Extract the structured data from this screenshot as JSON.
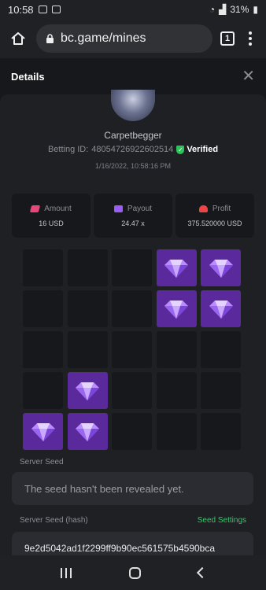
{
  "status_bar": {
    "time": "10:58",
    "battery": "31%"
  },
  "browser": {
    "url": "bc.game/mines",
    "tab_count": "1"
  },
  "modal": {
    "title": "Details"
  },
  "bet": {
    "username": "Carpetbegger",
    "betting_id_label": "Betting ID:",
    "betting_id": "48054726922602514",
    "verified_label": "Verified",
    "date": "1/16/2022, 10:58:16 PM"
  },
  "stats": {
    "amount_label": "Amount",
    "amount_value": "16 USD",
    "payout_label": "Payout",
    "payout_value": "24.47 x",
    "profit_label": "Profit",
    "profit_value": "375.520000 USD"
  },
  "mines_grid": {
    "rows": 5,
    "cols": 5,
    "gems": [
      [
        0,
        3
      ],
      [
        0,
        4
      ],
      [
        1,
        3
      ],
      [
        1,
        4
      ],
      [
        3,
        1
      ],
      [
        4,
        0
      ],
      [
        4,
        1
      ]
    ],
    "gem_color": "#5a2a9c"
  },
  "server_seed": {
    "label": "Server Seed",
    "value": "The seed hasn't been revealed yet."
  },
  "server_seed_hash": {
    "label": "Server Seed (hash)",
    "settings_label": "Seed Settings",
    "value": "9e2d5042ad1f2299ff9b90ec561575b4590bca"
  },
  "colors": {
    "accent_green": "#3cc56a",
    "verified_green": "#2bc35a",
    "gem_purple": "#5a2a9c"
  }
}
